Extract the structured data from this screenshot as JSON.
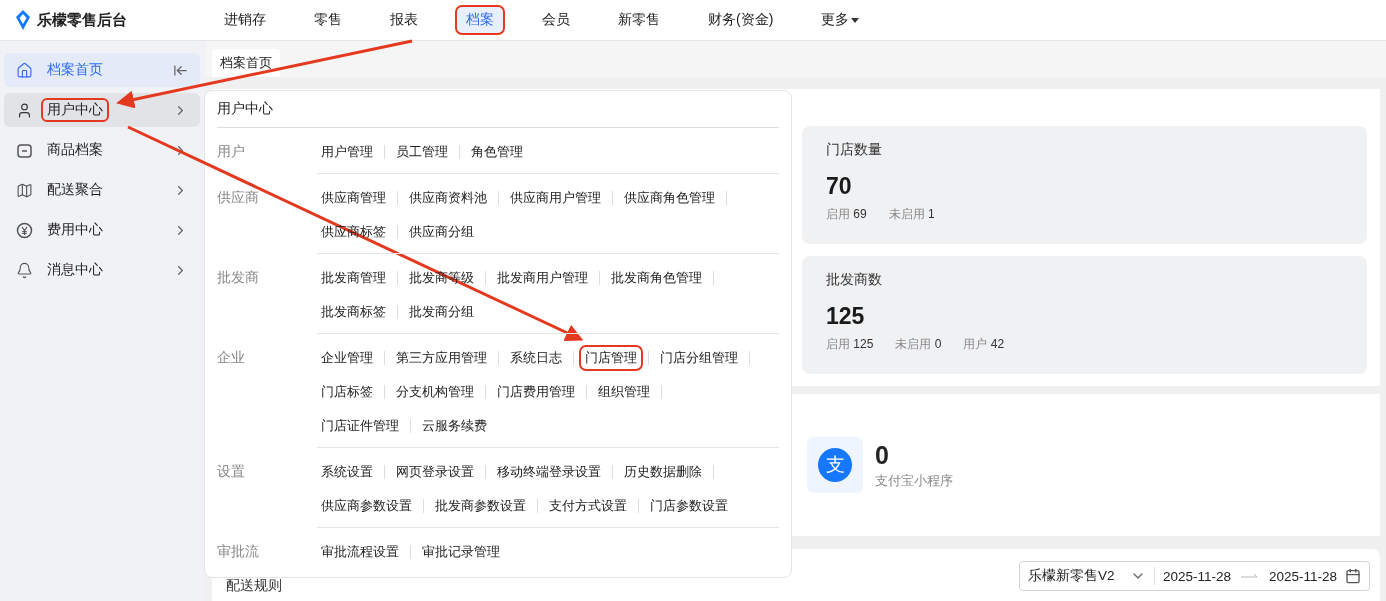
{
  "app": {
    "logo_name": "乐檬零售后台"
  },
  "nav": [
    {
      "label": "进销存",
      "selected": false,
      "annotated": false
    },
    {
      "label": "零售",
      "selected": false,
      "annotated": false
    },
    {
      "label": "报表",
      "selected": false,
      "annotated": false
    },
    {
      "label": "档案",
      "selected": true,
      "annotated": true
    },
    {
      "label": "会员",
      "selected": false,
      "annotated": false
    },
    {
      "label": "新零售",
      "selected": false,
      "annotated": false
    },
    {
      "label": "财务(资金)",
      "selected": false,
      "annotated": false
    },
    {
      "label": "更多",
      "selected": false,
      "annotated": false,
      "kind": "dropdown"
    }
  ],
  "sidebar": {
    "items": [
      {
        "label": "档案首页",
        "selected": true,
        "open": false,
        "annotated": false,
        "kind": "home"
      },
      {
        "label": "用户中心",
        "selected": false,
        "open": true,
        "annotated": true,
        "kind": "group"
      },
      {
        "label": "商品档案",
        "selected": false,
        "open": false,
        "annotated": false,
        "kind": "group"
      },
      {
        "label": "配送聚合",
        "selected": false,
        "open": false,
        "annotated": false,
        "kind": "group"
      },
      {
        "label": "费用中心",
        "selected": false,
        "open": false,
        "annotated": false,
        "kind": "group"
      },
      {
        "label": "消息中心",
        "selected": false,
        "open": false,
        "annotated": false,
        "kind": "group"
      }
    ]
  },
  "tabs": [
    {
      "label": "档案首页",
      "selected": true
    }
  ],
  "flyout": {
    "title": "用户中心",
    "sections": [
      {
        "label": "用户",
        "rows": [
          [
            {
              "label": "用户管理",
              "annotated": false
            },
            {
              "label": "员工管理",
              "annotated": false
            },
            {
              "label": "角色管理",
              "annotated": false
            }
          ]
        ]
      },
      {
        "label": "供应商",
        "rows": [
          [
            {
              "label": "供应商管理",
              "annotated": false
            },
            {
              "label": "供应商资料池",
              "annotated": false
            },
            {
              "label": "供应商用户管理",
              "annotated": false
            },
            {
              "label": "供应商角色管理",
              "annotated": false
            }
          ],
          [
            {
              "label": "供应商标签",
              "annotated": false
            },
            {
              "label": "供应商分组",
              "annotated": false
            }
          ]
        ]
      },
      {
        "label": "批发商",
        "rows": [
          [
            {
              "label": "批发商管理",
              "annotated": false
            },
            {
              "label": "批发商等级",
              "annotated": false
            },
            {
              "label": "批发商用户管理",
              "annotated": false
            },
            {
              "label": "批发商角色管理",
              "annotated": false
            }
          ],
          [
            {
              "label": "批发商标签",
              "annotated": false
            },
            {
              "label": "批发商分组",
              "annotated": false
            }
          ]
        ]
      },
      {
        "label": "企业",
        "rows": [
          [
            {
              "label": "企业管理",
              "annotated": false
            },
            {
              "label": "第三方应用管理",
              "annotated": false
            },
            {
              "label": "系统日志",
              "annotated": false
            },
            {
              "label": "门店管理",
              "annotated": true
            },
            {
              "label": "门店分组管理",
              "annotated": false
            }
          ],
          [
            {
              "label": "门店标签",
              "annotated": false
            },
            {
              "label": "分支机构管理",
              "annotated": false
            },
            {
              "label": "门店费用管理",
              "annotated": false
            },
            {
              "label": "组织管理",
              "annotated": false
            }
          ],
          [
            {
              "label": "门店证件管理",
              "annotated": false
            },
            {
              "label": "云服务续费",
              "annotated": false
            }
          ]
        ]
      },
      {
        "label": "设置",
        "rows": [
          [
            {
              "label": "系统设置",
              "annotated": false
            },
            {
              "label": "网页登录设置",
              "annotated": false
            },
            {
              "label": "移动终端登录设置",
              "annotated": false
            },
            {
              "label": "历史数据删除",
              "annotated": false
            }
          ],
          [
            {
              "label": "供应商参数设置",
              "annotated": false
            },
            {
              "label": "批发商参数设置",
              "annotated": false
            },
            {
              "label": "支付方式设置",
              "annotated": false
            },
            {
              "label": "门店参数设置",
              "annotated": false
            }
          ]
        ]
      },
      {
        "label": "审批流",
        "rows": [
          [
            {
              "label": "审批流程设置",
              "annotated": false
            },
            {
              "label": "审批记录管理",
              "annotated": false
            }
          ]
        ]
      }
    ]
  },
  "stat_cards": [
    {
      "title": "门店数量",
      "value": "70",
      "stats": [
        {
          "label": "启用",
          "value": "69"
        },
        {
          "label": "未启用",
          "value": "1"
        }
      ]
    },
    {
      "title": "批发商数",
      "value": "125",
      "stats": [
        {
          "label": "启用",
          "value": "125"
        },
        {
          "label": "未启用",
          "value": "0"
        },
        {
          "label": "用户",
          "value": "42"
        }
      ]
    }
  ],
  "mini_program": {
    "logo_text": "支",
    "count": "0",
    "label": "支付宝小程序"
  },
  "rules_panel": {
    "title": "配送规则",
    "brand_select": "乐檬新零售V2",
    "date_from": "2025-11-28",
    "date_to": "2025-11-28"
  }
}
